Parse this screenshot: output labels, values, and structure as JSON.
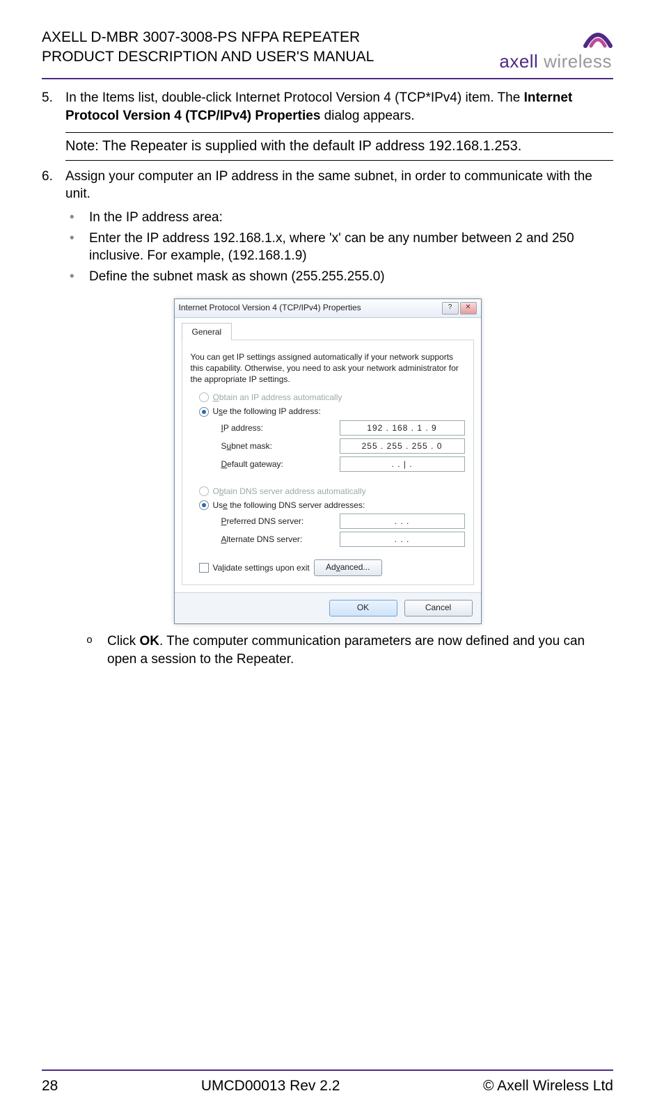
{
  "header": {
    "line1": "AXELL D-MBR 3007-3008-PS NFPA REPEATER",
    "line2": "PRODUCT DESCRIPTION AND USER'S MANUAL",
    "logo_main": "axell",
    "logo_sub": "wireless"
  },
  "step5": {
    "num": "5.",
    "text_a": "In the Items list, double-click Internet Protocol Version 4 (TCP*IPv4) item. The ",
    "text_b": "Internet Protocol Version 4 (TCP/IPv4) Properties",
    "text_c": " dialog appears."
  },
  "note": "Note:  The Repeater is supplied with the default IP address 192.168.1.253.",
  "step6": {
    "num": "6.",
    "text": "Assign your computer an IP address in the same subnet, in order to communicate with the unit.",
    "b1": "In the IP address area:",
    "b2": "Enter the IP address 192.168.1.x, where 'x' can be any number between 2 and 250 inclusive. For example,  (192.168.1.9)",
    "b3": "Define the subnet mask as shown (255.255.255.0)"
  },
  "dialog": {
    "title": "Internet Protocol Version 4 (TCP/IPv4) Properties",
    "help": "?",
    "close": "✕",
    "tab": "General",
    "desc": "You can get IP settings assigned automatically if your network supports this capability. Otherwise, you need to ask your network administrator for the appropriate IP settings.",
    "r1": "Obtain an IP address automatically",
    "r2": "Use the following IP address:",
    "ip_lbl": "IP address:",
    "ip_val": "192 . 168 .   1   .   9",
    "sm_lbl": "Subnet mask:",
    "sm_val": "255 . 255 . 255 .   0",
    "gw_lbl": "Default gateway:",
    "gw_val": ".       .   |   .",
    "r3": "Obtain DNS server address automatically",
    "r4": "Use the following DNS server addresses:",
    "pd_lbl": "Preferred DNS server:",
    "pd_val": ".       .       .",
    "ad_lbl": "Alternate DNS server:",
    "ad_val": ".       .       .",
    "validate": "Validate settings upon exit",
    "advanced": "Advanced...",
    "ok": "OK",
    "cancel": "Cancel"
  },
  "sub_o": {
    "a": "Click ",
    "b": "OK",
    "c": ". The computer communication parameters are now defined and you can open a session to the Repeater."
  },
  "footer": {
    "left": "28",
    "mid": "UMCD00013 Rev 2.2",
    "right": "© Axell Wireless Ltd"
  }
}
